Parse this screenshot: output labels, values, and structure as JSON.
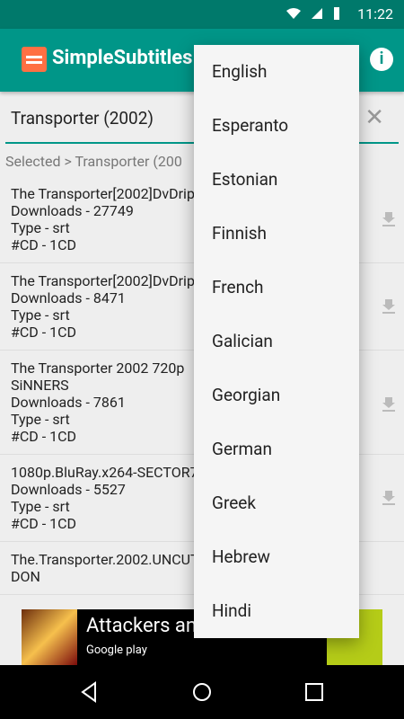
{
  "status_bar": {
    "time": "11:22"
  },
  "app_bar": {
    "title": "SimpleSubtitles"
  },
  "search": {
    "value": "Transporter (2002)"
  },
  "breadcrumb": "Selected > Transporter (200",
  "results": [
    {
      "title": "The Transporter[2002]DvDrip",
      "downloads": "Downloads - 27749",
      "type": "Type - srt",
      "cd": "#CD - 1CD"
    },
    {
      "title": "The Transporter[2002]DvDrip",
      "downloads": "Downloads - 8471",
      "type": "Type - srt",
      "cd": "#CD - 1CD"
    },
    {
      "title": "The Transporter 2002 720p ",
      "title2": "SiNNERS",
      "downloads": "Downloads - 7861",
      "type": "Type - srt",
      "cd": "#CD - 1CD"
    },
    {
      "title": "1080p.BluRay.x264-SECTOR7",
      "downloads": "Downloads - 5527",
      "type": "Type - srt",
      "cd": "#CD - 1CD"
    },
    {
      "title": "The.Transporter.2002.UNCUT",
      "title2": "DON"
    }
  ],
  "ad": {
    "headline": "Attackers an",
    "store": "Google play"
  },
  "dropdown": {
    "options": [
      "English",
      "Esperanto",
      "Estonian",
      "Finnish",
      "French",
      "Galician",
      "Georgian",
      "German",
      "Greek",
      "Hebrew",
      "Hindi"
    ]
  }
}
